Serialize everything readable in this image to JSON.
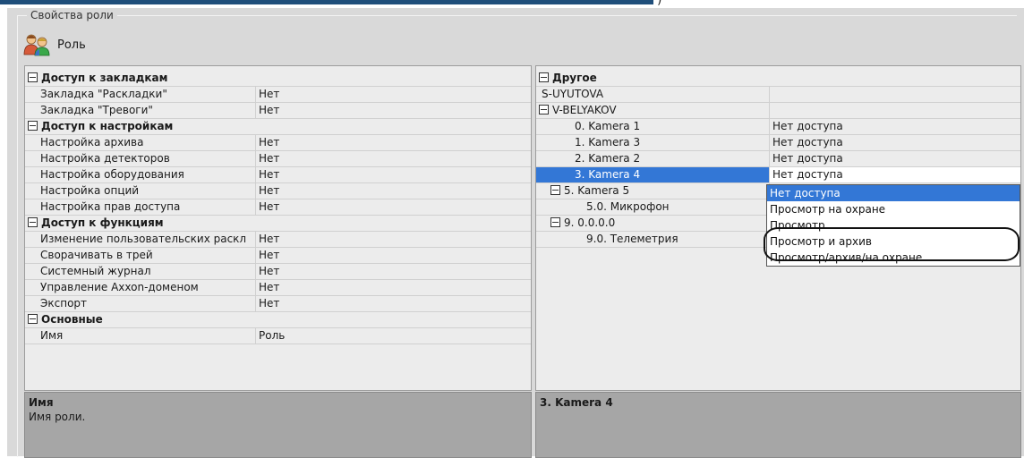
{
  "group_title": "Свойства роли",
  "role_name": "Роль",
  "left_rows": [
    {
      "type": "cat",
      "label": "Доступ к закладкам"
    },
    {
      "type": "item",
      "label": "Закладка \"Раскладки\"",
      "value": "Нет"
    },
    {
      "type": "item",
      "label": "Закладка \"Тревоги\"",
      "value": "Нет"
    },
    {
      "type": "cat",
      "label": "Доступ к настройкам"
    },
    {
      "type": "item",
      "label": "Настройка архива",
      "value": "Нет"
    },
    {
      "type": "item",
      "label": "Настройка детекторов",
      "value": "Нет"
    },
    {
      "type": "item",
      "label": "Настройка оборудования",
      "value": "Нет"
    },
    {
      "type": "item",
      "label": "Настройка опций",
      "value": "Нет"
    },
    {
      "type": "item",
      "label": "Настройка прав доступа",
      "value": "Нет"
    },
    {
      "type": "cat",
      "label": "Доступ к функциям"
    },
    {
      "type": "item",
      "label": "Изменение пользовательских раскл",
      "value": "Нет"
    },
    {
      "type": "item",
      "label": "Сворачивать в трей",
      "value": "Нет"
    },
    {
      "type": "item",
      "label": "Системный журнал",
      "value": "Нет"
    },
    {
      "type": "item",
      "label": "Управление Axxon-доменом",
      "value": "Нет"
    },
    {
      "type": "item",
      "label": "Экспорт",
      "value": "Нет"
    },
    {
      "type": "cat",
      "label": "Основные"
    },
    {
      "type": "item",
      "label": "Имя",
      "value": "Роль"
    }
  ],
  "right_rows": [
    {
      "type": "cat",
      "label": "Другое",
      "indent": 0
    },
    {
      "type": "plain",
      "label": "S-UYUTOVA",
      "value": "",
      "indent": 0
    },
    {
      "type": "group",
      "label": "V-BELYAKOV",
      "value": "",
      "indent": 0
    },
    {
      "type": "plain",
      "label": "0. Kamera 1",
      "value": "Нет доступа",
      "indent": 2
    },
    {
      "type": "plain",
      "label": "1. Kamera 3",
      "value": "Нет доступа",
      "indent": 2
    },
    {
      "type": "plain",
      "label": "2. Kamera 2",
      "value": "Нет доступа",
      "indent": 2
    },
    {
      "type": "selected",
      "label": "3. Kamera 4",
      "value": "Нет доступа",
      "indent": 2
    },
    {
      "type": "group",
      "label": "5. Kamera 5",
      "value": "",
      "indent": 1
    },
    {
      "type": "plain",
      "label": "5.0. Микрофон",
      "value": "",
      "indent": 3
    },
    {
      "type": "group",
      "label": "9. 0.0.0.0",
      "value": "",
      "indent": 1
    },
    {
      "type": "plain",
      "label": "9.0. Телеметрия",
      "value": "",
      "indent": 3
    }
  ],
  "dropdown_options": [
    "Нет доступа",
    "Просмотр на охране",
    "Просмотр",
    "Просмотр и архив",
    "Просмотр/архив/на охране"
  ],
  "dropdown_selected_index": 0,
  "left_desc": {
    "title": "Имя",
    "body": "Имя роли."
  },
  "right_desc": {
    "title": "3. Kamera 4",
    "body": ""
  },
  "colors": {
    "selection": "#3377d6",
    "panel": "#ececec",
    "description": "#a6a6a6"
  },
  "icons": {
    "role": "users-icon",
    "toggle": "collapse-toggle-icon",
    "dropdown": "chevron-down-icon"
  }
}
